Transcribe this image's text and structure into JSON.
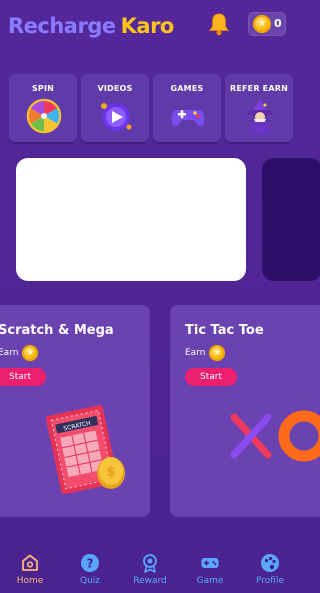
{
  "header": {
    "brand_part1": "Recharge",
    "brand_part2": "Karo",
    "coin_balance": "0",
    "icons": [
      "bell-icon",
      "coin-icon"
    ]
  },
  "tiles": [
    {
      "label": "SPIN",
      "icon": "spin-wheel-icon"
    },
    {
      "label": "VIDEOS",
      "icon": "video-play-icon"
    },
    {
      "label": "GAMES",
      "icon": "gamepad-icon"
    },
    {
      "label": "REFER EARN",
      "icon": "wizard-icon"
    }
  ],
  "games": [
    {
      "title": "Scratch & Mega",
      "earn_label": "Earn",
      "start_label": "Start",
      "art_text": "SCRATCH"
    },
    {
      "title": "Tic Tac Toe",
      "earn_label": "Earn",
      "start_label": "Start"
    }
  ],
  "nav": [
    {
      "label": "Home",
      "icon": "home-icon",
      "active": true
    },
    {
      "label": "Quiz",
      "icon": "question-icon",
      "active": false
    },
    {
      "label": "Reward",
      "icon": "medal-icon",
      "active": false
    },
    {
      "label": "Game",
      "icon": "gamepad-icon",
      "active": false
    },
    {
      "label": "Profile",
      "icon": "palette-icon",
      "active": false
    }
  ],
  "colors": {
    "background": "#53279a",
    "brand_primary": "#8a7bff",
    "brand_accent": "#ffc61a",
    "start_button": "#ec1f6e",
    "nav_active": "#ffb37a",
    "nav_inactive": "#5aa6ff"
  }
}
